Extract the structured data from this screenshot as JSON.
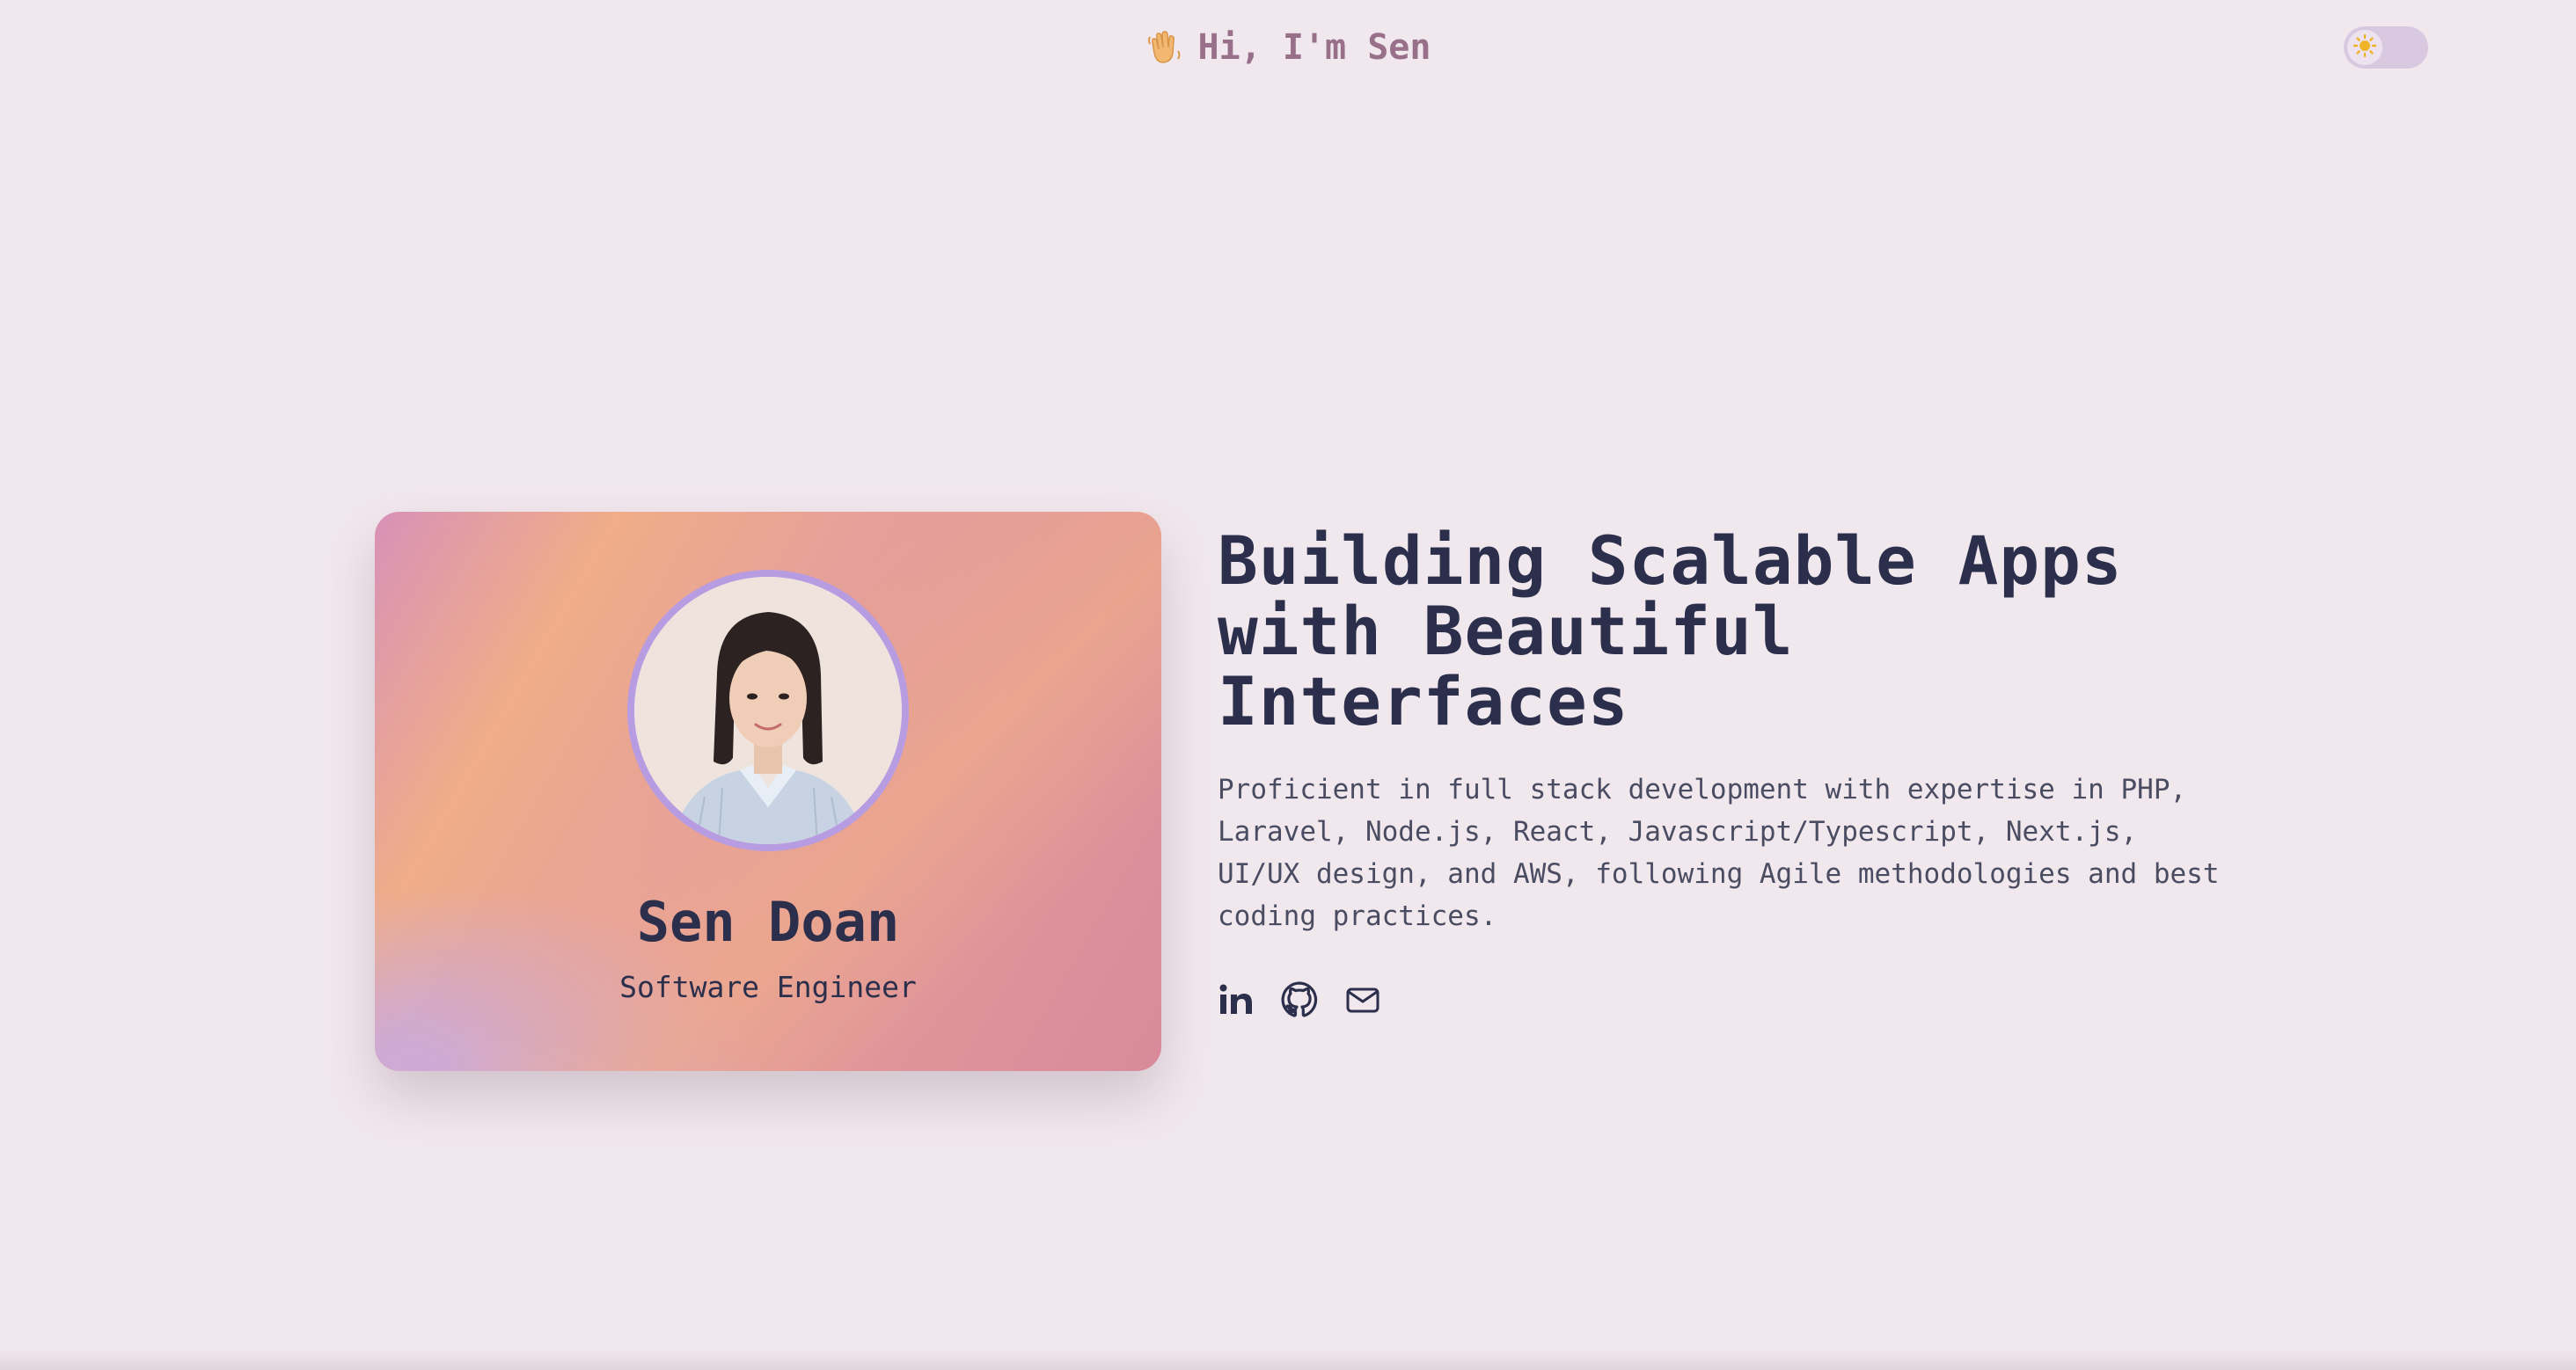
{
  "nav": {
    "brand_emoji_icon": "waving-hand-icon",
    "brand_text": "Hi, I'm Sen",
    "theme_toggle_icon": "sun-icon"
  },
  "profile_card": {
    "name": "Sen Doan",
    "role": "Software Engineer"
  },
  "hero": {
    "headline_line1": "Building Scalable Apps",
    "headline_line2": "with Beautiful Interfaces",
    "description": "Proficient in full stack development with expertise in PHP, Laravel, Node.js, React, Javascript/Typescript, Next.js, UI/UX design, and AWS, following Agile methodologies and best coding practices.",
    "socials": [
      {
        "icon": "linkedin-icon"
      },
      {
        "icon": "github-icon"
      },
      {
        "icon": "mail-icon"
      }
    ]
  },
  "colors": {
    "background": "#f1e8ed",
    "text_dark": "#2b2f4b",
    "brand": "#98708a",
    "avatar_ring": "#b89ce2",
    "sun": "#f0b429"
  }
}
